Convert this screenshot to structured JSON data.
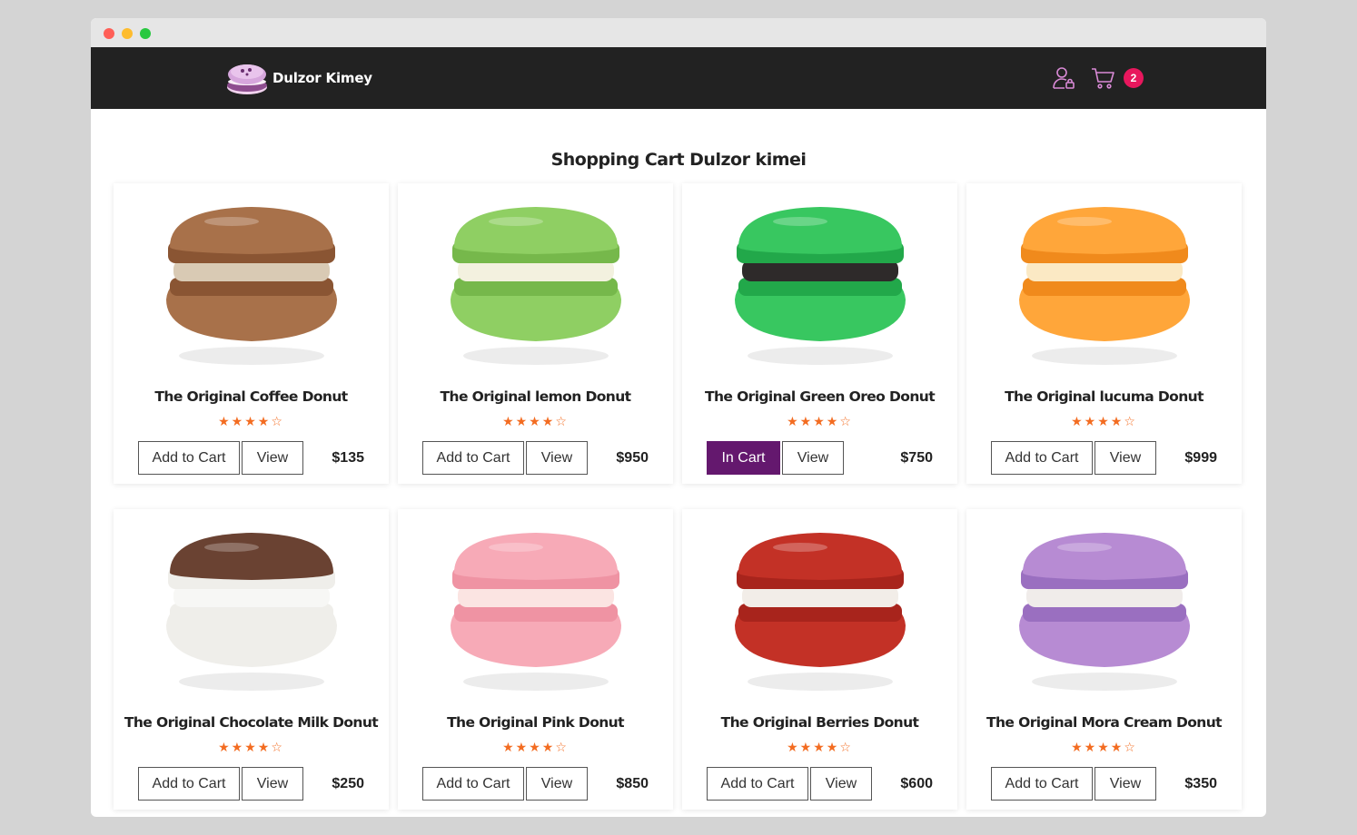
{
  "brand": {
    "name": "Dulzor Kimey"
  },
  "header": {
    "cart_count": "2"
  },
  "page": {
    "title": "Shopping Cart Dulzor kimei"
  },
  "products": [
    {
      "name": "The Original Coffee Donut",
      "price": "$135",
      "action": "Add to Cart",
      "view": "View",
      "in_cart": false,
      "rating": 4,
      "colors": {
        "shell": "#a8714a",
        "shell_dark": "#8a5533",
        "filling": "#d9cab4"
      }
    },
    {
      "name": "The Original lemon Donut",
      "price": "$950",
      "action": "Add to Cart",
      "view": "View",
      "in_cart": false,
      "rating": 4,
      "colors": {
        "shell": "#8fcf63",
        "shell_dark": "#76b84b",
        "filling": "#f3f1df"
      }
    },
    {
      "name": "The Original Green Oreo Donut",
      "price": "$750",
      "action": "In Cart",
      "view": "View",
      "in_cart": true,
      "rating": 4,
      "colors": {
        "shell": "#38c760",
        "shell_dark": "#22a84a",
        "filling": "#2e2a2a"
      }
    },
    {
      "name": "The Original lucuma Donut",
      "price": "$999",
      "action": "Add to Cart",
      "view": "View",
      "in_cart": false,
      "rating": 4,
      "colors": {
        "shell": "#ffa63a",
        "shell_dark": "#f08a1c",
        "filling": "#fbe9c4"
      }
    },
    {
      "name": "The Original Chocolate Milk Donut",
      "price": "$250",
      "action": "Add to Cart",
      "view": "View",
      "in_cart": false,
      "rating": 4,
      "colors": {
        "shell": "#6a4232",
        "shell_dark": "#efeeea",
        "filling": "#f7f7f5"
      }
    },
    {
      "name": "The Original Pink Donut",
      "price": "$850",
      "action": "Add to Cart",
      "view": "View",
      "in_cart": false,
      "rating": 4,
      "colors": {
        "shell": "#f7aab7",
        "shell_dark": "#ef93a3",
        "filling": "#fbe4e2"
      }
    },
    {
      "name": "The Original Berries Donut",
      "price": "$600",
      "action": "Add to Cart",
      "view": "View",
      "in_cart": false,
      "rating": 4,
      "colors": {
        "shell": "#c33126",
        "shell_dark": "#a8241c",
        "filling": "#f2ede8"
      }
    },
    {
      "name": "The Original Mora Cream Donut",
      "price": "$350",
      "action": "Add to Cart",
      "view": "View",
      "in_cart": false,
      "rating": 4,
      "colors": {
        "shell": "#b78bd3",
        "shell_dark": "#9a6fc0",
        "filling": "#f0ecea"
      }
    }
  ],
  "theme": {
    "nav_bg": "#222222",
    "accent": "#64186e",
    "star": "#f36c21",
    "badge": "#e8175d"
  }
}
